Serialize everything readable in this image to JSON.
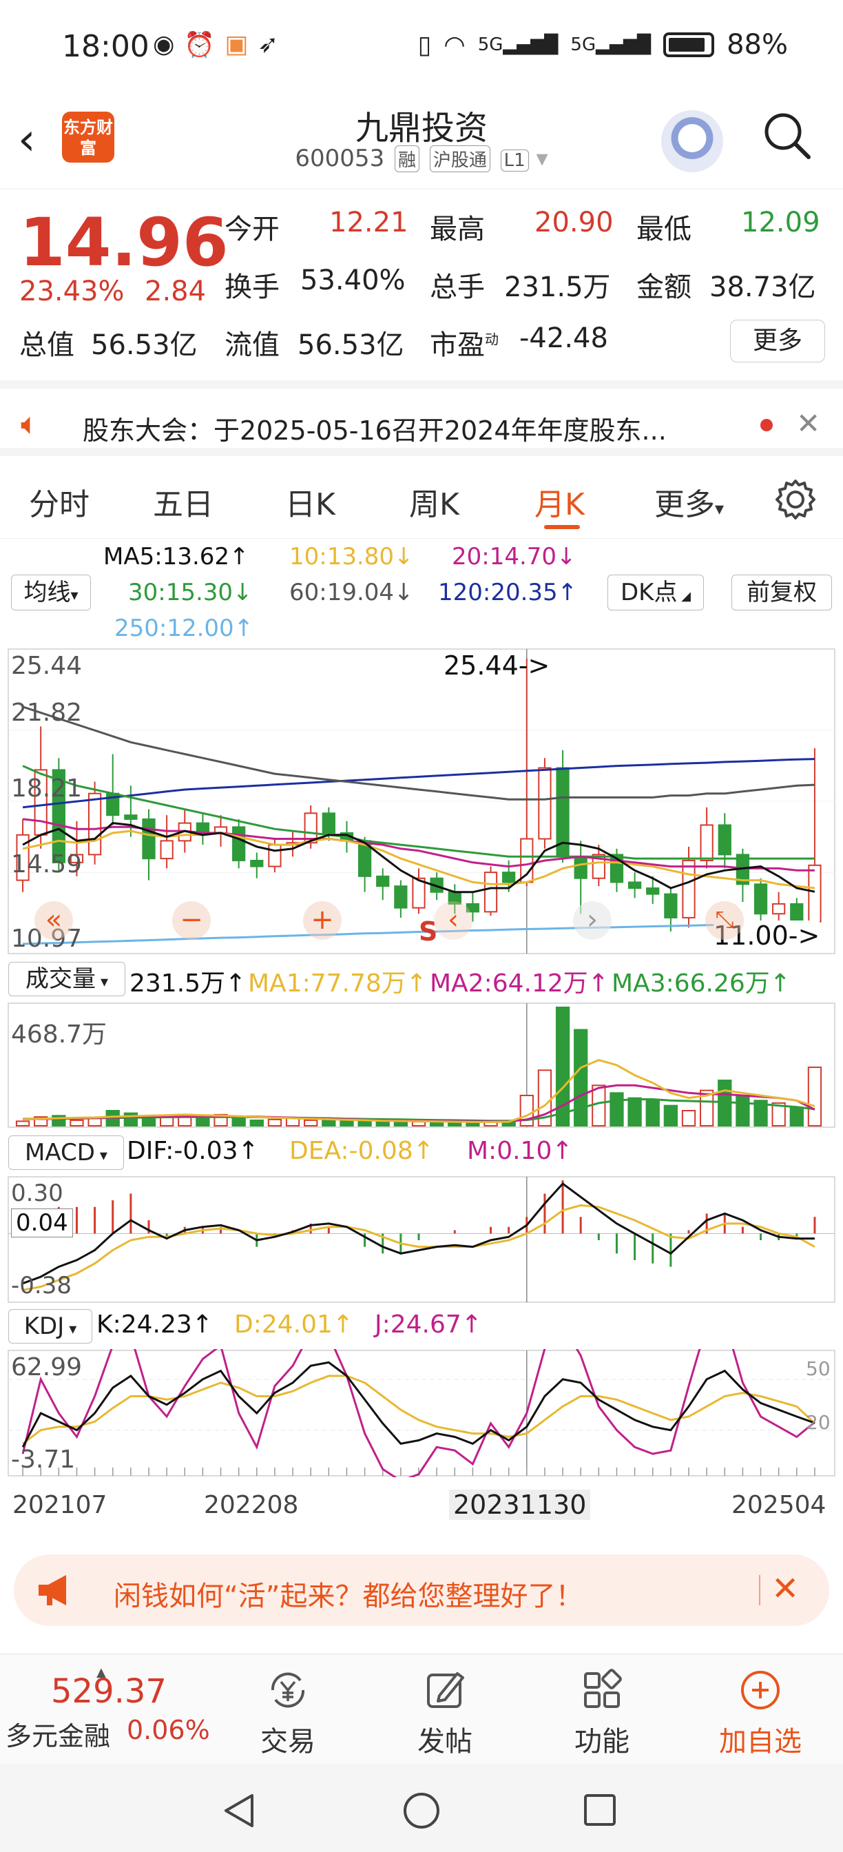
{
  "status_bar": {
    "time": "18:00",
    "battery": "88%",
    "net1": "5G",
    "net2": "5G"
  },
  "header": {
    "logo_text": "东方财富",
    "title": "九鼎投资",
    "code": "600053",
    "tags": [
      "融",
      "沪股通",
      "L1"
    ]
  },
  "quote": {
    "price": "14.96",
    "pct": "23.43%",
    "change": "2.84",
    "open_label": "今开",
    "open": "12.21",
    "high_label": "最高",
    "high": "20.90",
    "low_label": "最低",
    "low": "12.09",
    "turnover_label": "换手",
    "turnover": "53.40%",
    "volume_label": "总手",
    "volume": "231.5万",
    "amount_label": "金额",
    "amount": "38.73亿",
    "mktcap_label": "总值",
    "mktcap": "56.53亿",
    "float_label": "流值",
    "float": "56.53亿",
    "pe_label": "市盈",
    "pe_sup": "动",
    "pe": "-42.48",
    "more": "更多"
  },
  "notice": {
    "text": "股东大会：于2025-05-16召开2024年年度股东..."
  },
  "tabs": [
    {
      "label": "分时"
    },
    {
      "label": "五日"
    },
    {
      "label": "日K"
    },
    {
      "label": "周K"
    },
    {
      "label": "月K"
    },
    {
      "label": "更多"
    }
  ],
  "ma": {
    "selector": "均线",
    "ma5": "MA5:13.62↑",
    "ma10": "10:13.80↓",
    "ma20": "20:14.70↓",
    "ma30": "30:15.30↓",
    "ma60": "60:19.04↓",
    "ma120": "120:20.35↑",
    "ma250": "250:12.00↑",
    "dk": "DK点",
    "adjust": "前复权"
  },
  "main_chart": {
    "yticks": [
      "25.44",
      "21.82",
      "18.21",
      "14.59",
      "10.97"
    ],
    "high_marker": "25.44->",
    "low_marker": "11.00->",
    "signal": "S",
    "current_value": "14.96"
  },
  "volume": {
    "selector": "成交量",
    "value": "231.5万↑",
    "ma1": "MA1:77.78万↑",
    "ma2": "MA2:64.12万↑",
    "ma3": "MA3:66.26万↑",
    "ytick": "468.7万"
  },
  "macd": {
    "selector": "MACD",
    "dif": "DIF:-0.03↑",
    "dea": "DEA:-0.08↑",
    "m": "M:0.10↑",
    "ytop": "0.30",
    "ymid": "0.04",
    "ybottom": "-0.38"
  },
  "kdj": {
    "selector": "KDJ",
    "k": "K:24.23↑",
    "d": "D:24.01↑",
    "j": "J:24.67↑",
    "ytop": "62.99",
    "ybottom": "-3.71",
    "r50": "50",
    "r20": "20"
  },
  "xaxis": [
    "202107",
    "202208",
    "20231130",
    "202504"
  ],
  "promo": {
    "text": "闲钱如何“活”起来？都给您整理好了！"
  },
  "bottom": {
    "index_value": "529.37",
    "index_name": "多元金融",
    "index_pct": "0.06%",
    "trade": "交易",
    "post": "发帖",
    "func": "功能",
    "add": "加自选"
  },
  "colors": {
    "up": "#d43a2c",
    "down": "#2e9a3a",
    "accent": "#e9541b",
    "ma5": "#111111",
    "ma10": "#e8b830",
    "ma20": "#c0208a",
    "ma30": "#2e9a3a",
    "ma60": "#555555",
    "ma120": "#1b2fa0",
    "ma250": "#6ab4e8"
  },
  "chart_data": {
    "type": "candlestick",
    "period": "monthly",
    "candles": [
      {
        "o": 14.2,
        "c": 16.5,
        "h": 17.3,
        "l": 13.6
      },
      {
        "o": 16.5,
        "c": 19.8,
        "h": 22.0,
        "l": 15.8
      },
      {
        "o": 19.8,
        "c": 15.1,
        "h": 20.4,
        "l": 14.6
      },
      {
        "o": 15.1,
        "c": 15.5,
        "h": 17.2,
        "l": 14.4
      },
      {
        "o": 15.5,
        "c": 18.6,
        "h": 19.2,
        "l": 15.0
      },
      {
        "o": 18.6,
        "c": 17.5,
        "h": 20.6,
        "l": 17.0
      },
      {
        "o": 17.5,
        "c": 17.3,
        "h": 19.0,
        "l": 16.4
      },
      {
        "o": 17.3,
        "c": 15.3,
        "h": 17.8,
        "l": 14.2
      },
      {
        "o": 15.3,
        "c": 16.2,
        "h": 17.5,
        "l": 14.8
      },
      {
        "o": 16.2,
        "c": 17.1,
        "h": 17.8,
        "l": 15.6
      },
      {
        "o": 17.1,
        "c": 16.6,
        "h": 17.6,
        "l": 16.0
      },
      {
        "o": 16.6,
        "c": 16.9,
        "h": 17.5,
        "l": 15.9
      },
      {
        "o": 16.9,
        "c": 15.2,
        "h": 17.3,
        "l": 14.8
      },
      {
        "o": 15.2,
        "c": 14.9,
        "h": 15.6,
        "l": 14.3
      },
      {
        "o": 14.9,
        "c": 16.0,
        "h": 16.3,
        "l": 14.6
      },
      {
        "o": 16.0,
        "c": 16.1,
        "h": 16.7,
        "l": 15.4
      },
      {
        "o": 16.1,
        "c": 17.6,
        "h": 18.0,
        "l": 15.8
      },
      {
        "o": 17.6,
        "c": 16.6,
        "h": 17.9,
        "l": 16.2
      },
      {
        "o": 16.6,
        "c": 16.2,
        "h": 17.2,
        "l": 15.6
      },
      {
        "o": 16.2,
        "c": 14.4,
        "h": 16.4,
        "l": 13.6
      },
      {
        "o": 14.4,
        "c": 13.9,
        "h": 14.8,
        "l": 13.2
      },
      {
        "o": 13.9,
        "c": 12.8,
        "h": 14.2,
        "l": 12.3
      },
      {
        "o": 12.8,
        "c": 14.3,
        "h": 14.8,
        "l": 12.5
      },
      {
        "o": 14.3,
        "c": 13.6,
        "h": 14.6,
        "l": 13.2
      },
      {
        "o": 13.6,
        "c": 13.0,
        "h": 14.0,
        "l": 12.5
      },
      {
        "o": 13.0,
        "c": 12.6,
        "h": 13.6,
        "l": 12.1
      },
      {
        "o": 12.6,
        "c": 14.6,
        "h": 14.9,
        "l": 12.4
      },
      {
        "o": 14.6,
        "c": 14.1,
        "h": 15.2,
        "l": 13.6
      },
      {
        "o": 14.1,
        "c": 16.3,
        "h": 25.44,
        "l": 13.9
      },
      {
        "o": 16.3,
        "c": 19.9,
        "h": 20.4,
        "l": 15.8
      },
      {
        "o": 19.9,
        "c": 15.4,
        "h": 20.8,
        "l": 15.1
      },
      {
        "o": 15.4,
        "c": 14.3,
        "h": 16.2,
        "l": 12.5
      },
      {
        "o": 14.3,
        "c": 15.5,
        "h": 16.0,
        "l": 13.9
      },
      {
        "o": 15.5,
        "c": 14.1,
        "h": 15.8,
        "l": 13.6
      },
      {
        "o": 14.1,
        "c": 13.8,
        "h": 14.6,
        "l": 13.3
      },
      {
        "o": 13.8,
        "c": 13.5,
        "h": 14.4,
        "l": 13.0
      },
      {
        "o": 13.5,
        "c": 12.3,
        "h": 13.8,
        "l": 11.6
      },
      {
        "o": 12.3,
        "c": 15.2,
        "h": 15.9,
        "l": 11.8
      },
      {
        "o": 15.2,
        "c": 17.0,
        "h": 17.9,
        "l": 14.8
      },
      {
        "o": 17.0,
        "c": 15.5,
        "h": 17.6,
        "l": 14.8
      },
      {
        "o": 15.5,
        "c": 14.0,
        "h": 15.8,
        "l": 13.1
      },
      {
        "o": 14.0,
        "c": 12.5,
        "h": 14.3,
        "l": 11.0
      },
      {
        "o": 12.5,
        "c": 13.0,
        "h": 13.6,
        "l": 12.1
      },
      {
        "o": 13.0,
        "c": 12.1,
        "h": 13.3,
        "l": 11.5
      },
      {
        "o": 12.1,
        "c": 14.96,
        "h": 20.9,
        "l": 12.09
      }
    ],
    "ma5": [
      16.0,
      16.5,
      16.8,
      16.2,
      16.3,
      17.1,
      17.0,
      16.7,
      16.4,
      16.7,
      16.5,
      16.6,
      16.3,
      15.9,
      15.7,
      15.8,
      16.2,
      16.5,
      16.5,
      16.1,
      15.4,
      14.7,
      14.2,
      13.9,
      13.6,
      13.6,
      13.8,
      13.8,
      14.5,
      15.7,
      16.1,
      16.0,
      15.8,
      15.3,
      14.7,
      14.3,
      13.8,
      14.1,
      14.5,
      14.7,
      14.8,
      14.9,
      14.4,
      13.8,
      13.62
    ],
    "ma10": [
      15.8,
      16.0,
      16.2,
      16.1,
      16.2,
      16.6,
      16.7,
      16.5,
      16.4,
      16.5,
      16.5,
      16.6,
      16.4,
      16.2,
      16.0,
      16.0,
      16.2,
      16.3,
      16.2,
      16.0,
      15.7,
      15.3,
      15.0,
      14.7,
      14.4,
      14.1,
      14.0,
      14.0,
      14.1,
      14.4,
      14.8,
      15.0,
      15.1,
      15.1,
      15.0,
      14.9,
      14.7,
      14.5,
      14.4,
      14.3,
      14.2,
      14.2,
      14.0,
      13.9,
      13.8
    ],
    "ma20": [
      17.3,
      17.2,
      17.0,
      16.8,
      16.8,
      16.9,
      16.9,
      16.8,
      16.7,
      16.7,
      16.6,
      16.6,
      16.5,
      16.4,
      16.3,
      16.3,
      16.3,
      16.3,
      16.2,
      16.1,
      16.0,
      15.8,
      15.7,
      15.5,
      15.3,
      15.1,
      15.0,
      14.9,
      15.0,
      15.2,
      15.3,
      15.4,
      15.3,
      15.2,
      15.1,
      15.0,
      14.9,
      14.9,
      14.9,
      14.9,
      14.8,
      14.8,
      14.8,
      14.7,
      14.7
    ],
    "ma30": [
      20.0,
      19.6,
      19.3,
      19.0,
      18.8,
      18.6,
      18.4,
      18.2,
      18.0,
      17.8,
      17.6,
      17.4,
      17.2,
      17.0,
      16.8,
      16.7,
      16.6,
      16.5,
      16.4,
      16.2,
      16.1,
      16.0,
      15.9,
      15.8,
      15.7,
      15.6,
      15.5,
      15.4,
      15.4,
      15.4,
      15.4,
      15.4,
      15.4,
      15.4,
      15.3,
      15.3,
      15.3,
      15.3,
      15.3,
      15.3,
      15.3,
      15.3,
      15.3,
      15.3,
      15.3
    ],
    "ma60": [
      23.0,
      22.7,
      22.4,
      22.1,
      21.8,
      21.5,
      21.2,
      21.0,
      20.8,
      20.6,
      20.4,
      20.2,
      20.0,
      19.8,
      19.6,
      19.5,
      19.4,
      19.3,
      19.2,
      19.1,
      19.0,
      18.9,
      18.8,
      18.7,
      18.6,
      18.5,
      18.4,
      18.3,
      18.3,
      18.3,
      18.4,
      18.4,
      18.4,
      18.4,
      18.4,
      18.4,
      18.5,
      18.5,
      18.6,
      18.6,
      18.7,
      18.8,
      18.9,
      19.0,
      19.04
    ],
    "ma120": [
      17.9,
      18.0,
      18.1,
      18.2,
      18.3,
      18.4,
      18.5,
      18.6,
      18.7,
      18.8,
      18.85,
      18.9,
      18.95,
      19.0,
      19.05,
      19.1,
      19.15,
      19.2,
      19.25,
      19.3,
      19.35,
      19.4,
      19.45,
      19.5,
      19.55,
      19.6,
      19.65,
      19.7,
      19.75,
      19.8,
      19.85,
      19.9,
      19.95,
      20.0,
      20.03,
      20.06,
      20.1,
      20.13,
      20.16,
      20.2,
      20.23,
      20.26,
      20.3,
      20.33,
      20.35
    ],
    "ma250": [
      10.97,
      11.0,
      11.02,
      11.05,
      11.08,
      11.1,
      11.13,
      11.16,
      11.19,
      11.22,
      11.25,
      11.28,
      11.3,
      11.33,
      11.36,
      11.39,
      11.42,
      11.44,
      11.47,
      11.5,
      11.52,
      11.55,
      11.58,
      11.6,
      11.62,
      11.65,
      11.67,
      11.7,
      11.72,
      11.74,
      11.76,
      11.78,
      11.8,
      11.82,
      11.84,
      11.86,
      11.88,
      11.9,
      11.92,
      11.94,
      11.95,
      11.96,
      11.97,
      11.98,
      12.0
    ],
    "volume": [
      18,
      35,
      40,
      22,
      30,
      60,
      50,
      36,
      40,
      45,
      32,
      44,
      38,
      22,
      25,
      30,
      22,
      28,
      20,
      18,
      15,
      14,
      16,
      14,
      13,
      12,
      18,
      20,
      120,
      220,
      470,
      380,
      160,
      130,
      110,
      100,
      80,
      60,
      140,
      180,
      120,
      100,
      90,
      70,
      231.5
    ],
    "vol_ma1": [
      25,
      28,
      30,
      32,
      33,
      36,
      38,
      40,
      42,
      44,
      42,
      40,
      38,
      35,
      32,
      30,
      28,
      26,
      24,
      22,
      20,
      19,
      18,
      17,
      16,
      15,
      15,
      16,
      40,
      80,
      150,
      230,
      260,
      240,
      200,
      170,
      130,
      110,
      120,
      140,
      130,
      120,
      110,
      100,
      77.78
    ],
    "vol_ma2": [
      26,
      27,
      28,
      30,
      31,
      33,
      35,
      36,
      37,
      38,
      38,
      38,
      37,
      36,
      34,
      32,
      30,
      28,
      26,
      24,
      22,
      21,
      20,
      19,
      18,
      17,
      17,
      17,
      25,
      45,
      80,
      120,
      150,
      160,
      160,
      150,
      140,
      130,
      125,
      125,
      120,
      115,
      110,
      100,
      64.12
    ],
    "vol_ma3": [
      27,
      28,
      28,
      29,
      30,
      31,
      32,
      33,
      34,
      35,
      35,
      35,
      35,
      34,
      33,
      32,
      31,
      30,
      28,
      27,
      26,
      25,
      24,
      23,
      22,
      21,
      20,
      20,
      23,
      33,
      50,
      70,
      90,
      100,
      105,
      105,
      100,
      98,
      96,
      94,
      90,
      86,
      80,
      74,
      66.26
    ],
    "macd_dif": [
      -0.3,
      -0.26,
      -0.2,
      -0.16,
      -0.1,
      0.0,
      0.08,
      0.02,
      -0.03,
      0.02,
      0.04,
      0.05,
      0.02,
      -0.04,
      -0.02,
      0.01,
      0.05,
      0.06,
      0.04,
      -0.02,
      -0.08,
      -0.12,
      -0.1,
      -0.08,
      -0.07,
      -0.08,
      -0.04,
      -0.02,
      0.05,
      0.18,
      0.3,
      0.22,
      0.14,
      0.06,
      0.0,
      -0.06,
      -0.12,
      -0.02,
      0.08,
      0.12,
      0.08,
      0.02,
      -0.02,
      -0.03,
      -0.03
    ],
    "macd_dea": [
      -0.34,
      -0.32,
      -0.28,
      -0.24,
      -0.18,
      -0.1,
      -0.04,
      -0.02,
      -0.02,
      0.0,
      0.02,
      0.03,
      0.02,
      0.0,
      -0.01,
      0.0,
      0.02,
      0.04,
      0.04,
      0.02,
      -0.02,
      -0.06,
      -0.08,
      -0.08,
      -0.08,
      -0.08,
      -0.06,
      -0.04,
      0.0,
      0.06,
      0.14,
      0.17,
      0.16,
      0.12,
      0.08,
      0.03,
      -0.02,
      -0.03,
      0.02,
      0.06,
      0.06,
      0.04,
      0.0,
      -0.02,
      -0.08
    ],
    "kdj_k": [
      10,
      30,
      25,
      20,
      30,
      45,
      52,
      40,
      35,
      42,
      50,
      55,
      40,
      30,
      42,
      48,
      58,
      60,
      52,
      38,
      24,
      12,
      14,
      18,
      16,
      12,
      20,
      14,
      22,
      40,
      50,
      48,
      38,
      32,
      26,
      22,
      20,
      34,
      50,
      55,
      44,
      36,
      32,
      28,
      24.23
    ],
    "kdj_d": [
      12,
      20,
      22,
      22,
      25,
      33,
      40,
      40,
      38,
      40,
      44,
      48,
      45,
      40,
      40,
      43,
      48,
      52,
      52,
      48,
      40,
      32,
      26,
      22,
      20,
      18,
      18,
      16,
      18,
      26,
      34,
      40,
      40,
      38,
      34,
      30,
      26,
      28,
      34,
      40,
      42,
      40,
      37,
      34,
      24.01
    ],
    "kdj_j": [
      6,
      50,
      30,
      16,
      40,
      70,
      76,
      40,
      28,
      46,
      62,
      70,
      30,
      10,
      46,
      58,
      78,
      76,
      52,
      18,
      -3,
      -10,
      -6,
      10,
      8,
      0,
      24,
      10,
      30,
      68,
      82,
      64,
      34,
      20,
      10,
      6,
      8,
      46,
      82,
      85,
      48,
      28,
      22,
      16,
      24.67
    ]
  }
}
